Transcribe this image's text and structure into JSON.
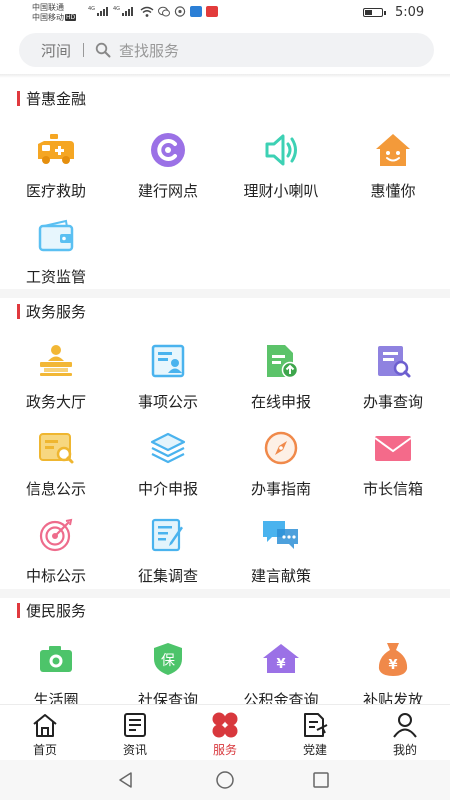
{
  "status_bar": {
    "carrier_1": "中国联通",
    "carrier_2": "中国移动",
    "hd_badge": "HD",
    "network_1": "4G",
    "network_2": "4G",
    "time": "5:09"
  },
  "search": {
    "city": "河间",
    "placeholder": "查找服务"
  },
  "sections": [
    {
      "title": "普惠金融",
      "items": [
        {
          "label": "医疗救助",
          "icon": "ambulance-icon"
        },
        {
          "label": "建行网点",
          "icon": "ccb-logo-icon"
        },
        {
          "label": "理财小喇叭",
          "icon": "speaker-icon"
        },
        {
          "label": "惠懂你",
          "icon": "smiling-house-icon"
        },
        {
          "label": "工资监管",
          "icon": "wallet-icon"
        }
      ]
    },
    {
      "title": "政务服务",
      "items": [
        {
          "label": "政务大厅",
          "icon": "service-counter-icon"
        },
        {
          "label": "事项公示",
          "icon": "notice-board-icon"
        },
        {
          "label": "在线申报",
          "icon": "upload-document-icon"
        },
        {
          "label": "办事查询",
          "icon": "document-search-icon"
        },
        {
          "label": "信息公示",
          "icon": "info-search-icon"
        },
        {
          "label": "中介申报",
          "icon": "layers-icon"
        },
        {
          "label": "办事指南",
          "icon": "compass-icon"
        },
        {
          "label": "市长信箱",
          "icon": "envelope-icon"
        },
        {
          "label": "中标公示",
          "icon": "target-icon"
        },
        {
          "label": "征集调查",
          "icon": "edit-form-icon"
        },
        {
          "label": "建言献策",
          "icon": "chat-bubbles-icon"
        }
      ]
    },
    {
      "title": "便民服务",
      "items": [
        {
          "label": "生活圈",
          "icon": "camera-icon"
        },
        {
          "label": "社保查询",
          "icon": "shield-icon",
          "glyph": "保"
        },
        {
          "label": "公积金查询",
          "icon": "yuan-house-icon",
          "glyph": "¥"
        },
        {
          "label": "补贴发放",
          "icon": "money-bag-icon",
          "glyph": "¥"
        }
      ]
    }
  ],
  "bottom_nav": [
    {
      "label": "首页",
      "icon": "home-icon",
      "active": false
    },
    {
      "label": "资讯",
      "icon": "news-icon",
      "active": false
    },
    {
      "label": "服务",
      "icon": "flower-grid-icon",
      "active": true
    },
    {
      "label": "党建",
      "icon": "party-doc-icon",
      "active": false
    },
    {
      "label": "我的",
      "icon": "user-icon",
      "active": false
    }
  ],
  "colors": {
    "accent": "#e0393e",
    "active_nav": "#d8383d",
    "search_bg": "#f1f2f4"
  }
}
